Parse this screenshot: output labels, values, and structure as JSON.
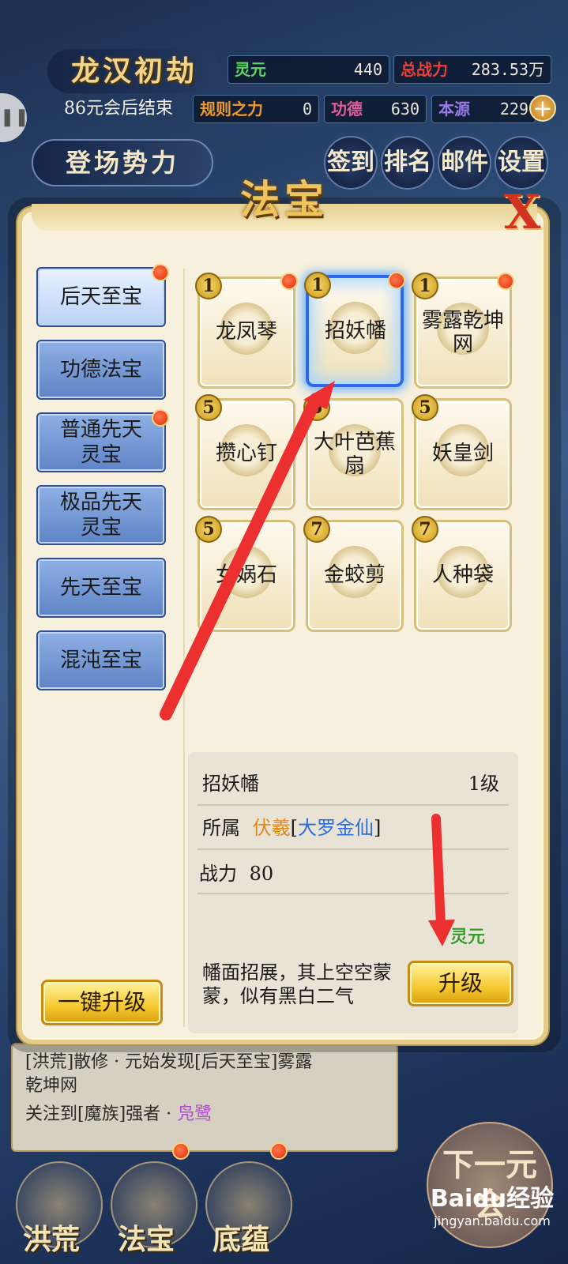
{
  "hud": {
    "title": "龙汉初劫",
    "subtitle": "86元会后结束",
    "resources": [
      {
        "label": "灵元",
        "value": "440"
      },
      {
        "label": "总战力",
        "value": "283.53万"
      },
      {
        "label": "规则之力",
        "value": "0"
      },
      {
        "label": "功德",
        "value": "630"
      },
      {
        "label": "本源",
        "value": "229"
      }
    ],
    "faction_button": "登场势力",
    "menu": [
      {
        "label": "签到"
      },
      {
        "label": "排名"
      },
      {
        "label": "邮件"
      },
      {
        "label": "设置"
      }
    ],
    "plus": "+",
    "side_handle": "❚❚"
  },
  "panel": {
    "title": "法宝",
    "close": "X",
    "categories": [
      {
        "label": "后天至宝",
        "active": true,
        "dot": true
      },
      {
        "label": "功德法宝",
        "active": false,
        "dot": false
      },
      {
        "label": "普通先天灵宝",
        "active": false,
        "dot": true
      },
      {
        "label": "极品先天灵宝",
        "active": false,
        "dot": false
      },
      {
        "label": "先天至宝",
        "active": false,
        "dot": false
      },
      {
        "label": "混沌至宝",
        "active": false,
        "dot": false
      }
    ],
    "items": [
      {
        "name": "龙凤琴",
        "level": "1",
        "dot": true
      },
      {
        "name": "招妖幡",
        "level": "1",
        "dot": true,
        "selected": true
      },
      {
        "name": "雾露乾坤网",
        "level": "1",
        "dot": true
      },
      {
        "name": "攒心钉",
        "level": "5"
      },
      {
        "name": "大叶芭蕉扇",
        "level": "5"
      },
      {
        "name": "妖皇剑",
        "level": "5"
      },
      {
        "name": "女娲石",
        "level": "5"
      },
      {
        "name": "金蛟剪",
        "level": "7"
      },
      {
        "name": "人种袋",
        "level": "7"
      }
    ],
    "detail": {
      "name": "招妖幡",
      "level": "1级",
      "owner_label": "所属",
      "owner_name": "伏羲",
      "owner_rank_open": "[",
      "owner_rank": "大罗金仙",
      "owner_rank_close": "]",
      "power_label": "战力",
      "power_value": "80",
      "description": "幡面招展，其上空空蒙蒙，似有黑白二气",
      "cost_label": "灵元",
      "upgrade_button": "升级"
    },
    "one_click_upgrade": "一键升级"
  },
  "log": {
    "line1": "[洪荒]散修 · 元始发现[后天至宝]雾露",
    "line2": "乾坤网",
    "line3_prefix": "关注到[魔族]强者 · ",
    "line3_name": "凫鹭"
  },
  "bottom_nav": [
    {
      "label": "洪荒"
    },
    {
      "label": "法宝"
    },
    {
      "label": "底蕴"
    }
  ],
  "next_button": "下一元会",
  "watermark": {
    "logo": "Baidu经验",
    "url": "jingyan.baidu.com"
  }
}
